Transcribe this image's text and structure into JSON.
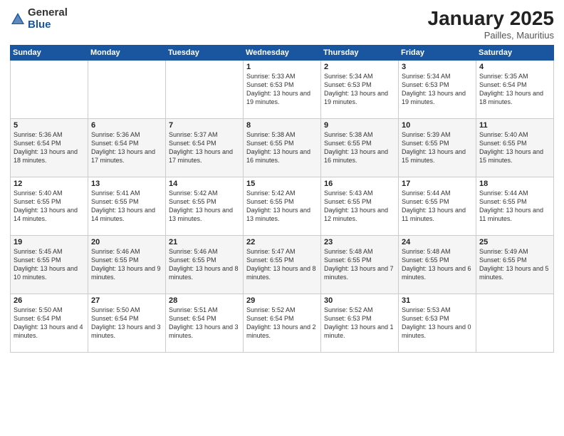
{
  "logo": {
    "general": "General",
    "blue": "Blue"
  },
  "title": "January 2025",
  "subtitle": "Pailles, Mauritius",
  "weekdays": [
    "Sunday",
    "Monday",
    "Tuesday",
    "Wednesday",
    "Thursday",
    "Friday",
    "Saturday"
  ],
  "weeks": [
    [
      {
        "day": "",
        "info": ""
      },
      {
        "day": "",
        "info": ""
      },
      {
        "day": "",
        "info": ""
      },
      {
        "day": "1",
        "info": "Sunrise: 5:33 AM\nSunset: 6:53 PM\nDaylight: 13 hours\nand 19 minutes."
      },
      {
        "day": "2",
        "info": "Sunrise: 5:34 AM\nSunset: 6:53 PM\nDaylight: 13 hours\nand 19 minutes."
      },
      {
        "day": "3",
        "info": "Sunrise: 5:34 AM\nSunset: 6:53 PM\nDaylight: 13 hours\nand 19 minutes."
      },
      {
        "day": "4",
        "info": "Sunrise: 5:35 AM\nSunset: 6:54 PM\nDaylight: 13 hours\nand 18 minutes."
      }
    ],
    [
      {
        "day": "5",
        "info": "Sunrise: 5:36 AM\nSunset: 6:54 PM\nDaylight: 13 hours\nand 18 minutes."
      },
      {
        "day": "6",
        "info": "Sunrise: 5:36 AM\nSunset: 6:54 PM\nDaylight: 13 hours\nand 17 minutes."
      },
      {
        "day": "7",
        "info": "Sunrise: 5:37 AM\nSunset: 6:54 PM\nDaylight: 13 hours\nand 17 minutes."
      },
      {
        "day": "8",
        "info": "Sunrise: 5:38 AM\nSunset: 6:55 PM\nDaylight: 13 hours\nand 16 minutes."
      },
      {
        "day": "9",
        "info": "Sunrise: 5:38 AM\nSunset: 6:55 PM\nDaylight: 13 hours\nand 16 minutes."
      },
      {
        "day": "10",
        "info": "Sunrise: 5:39 AM\nSunset: 6:55 PM\nDaylight: 13 hours\nand 15 minutes."
      },
      {
        "day": "11",
        "info": "Sunrise: 5:40 AM\nSunset: 6:55 PM\nDaylight: 13 hours\nand 15 minutes."
      }
    ],
    [
      {
        "day": "12",
        "info": "Sunrise: 5:40 AM\nSunset: 6:55 PM\nDaylight: 13 hours\nand 14 minutes."
      },
      {
        "day": "13",
        "info": "Sunrise: 5:41 AM\nSunset: 6:55 PM\nDaylight: 13 hours\nand 14 minutes."
      },
      {
        "day": "14",
        "info": "Sunrise: 5:42 AM\nSunset: 6:55 PM\nDaylight: 13 hours\nand 13 minutes."
      },
      {
        "day": "15",
        "info": "Sunrise: 5:42 AM\nSunset: 6:55 PM\nDaylight: 13 hours\nand 13 minutes."
      },
      {
        "day": "16",
        "info": "Sunrise: 5:43 AM\nSunset: 6:55 PM\nDaylight: 13 hours\nand 12 minutes."
      },
      {
        "day": "17",
        "info": "Sunrise: 5:44 AM\nSunset: 6:55 PM\nDaylight: 13 hours\nand 11 minutes."
      },
      {
        "day": "18",
        "info": "Sunrise: 5:44 AM\nSunset: 6:55 PM\nDaylight: 13 hours\nand 11 minutes."
      }
    ],
    [
      {
        "day": "19",
        "info": "Sunrise: 5:45 AM\nSunset: 6:55 PM\nDaylight: 13 hours\nand 10 minutes."
      },
      {
        "day": "20",
        "info": "Sunrise: 5:46 AM\nSunset: 6:55 PM\nDaylight: 13 hours\nand 9 minutes."
      },
      {
        "day": "21",
        "info": "Sunrise: 5:46 AM\nSunset: 6:55 PM\nDaylight: 13 hours\nand 8 minutes."
      },
      {
        "day": "22",
        "info": "Sunrise: 5:47 AM\nSunset: 6:55 PM\nDaylight: 13 hours\nand 8 minutes."
      },
      {
        "day": "23",
        "info": "Sunrise: 5:48 AM\nSunset: 6:55 PM\nDaylight: 13 hours\nand 7 minutes."
      },
      {
        "day": "24",
        "info": "Sunrise: 5:48 AM\nSunset: 6:55 PM\nDaylight: 13 hours\nand 6 minutes."
      },
      {
        "day": "25",
        "info": "Sunrise: 5:49 AM\nSunset: 6:55 PM\nDaylight: 13 hours\nand 5 minutes."
      }
    ],
    [
      {
        "day": "26",
        "info": "Sunrise: 5:50 AM\nSunset: 6:54 PM\nDaylight: 13 hours\nand 4 minutes."
      },
      {
        "day": "27",
        "info": "Sunrise: 5:50 AM\nSunset: 6:54 PM\nDaylight: 13 hours\nand 3 minutes."
      },
      {
        "day": "28",
        "info": "Sunrise: 5:51 AM\nSunset: 6:54 PM\nDaylight: 13 hours\nand 3 minutes."
      },
      {
        "day": "29",
        "info": "Sunrise: 5:52 AM\nSunset: 6:54 PM\nDaylight: 13 hours\nand 2 minutes."
      },
      {
        "day": "30",
        "info": "Sunrise: 5:52 AM\nSunset: 6:53 PM\nDaylight: 13 hours\nand 1 minute."
      },
      {
        "day": "31",
        "info": "Sunrise: 5:53 AM\nSunset: 6:53 PM\nDaylight: 13 hours\nand 0 minutes."
      },
      {
        "day": "",
        "info": ""
      }
    ]
  ]
}
